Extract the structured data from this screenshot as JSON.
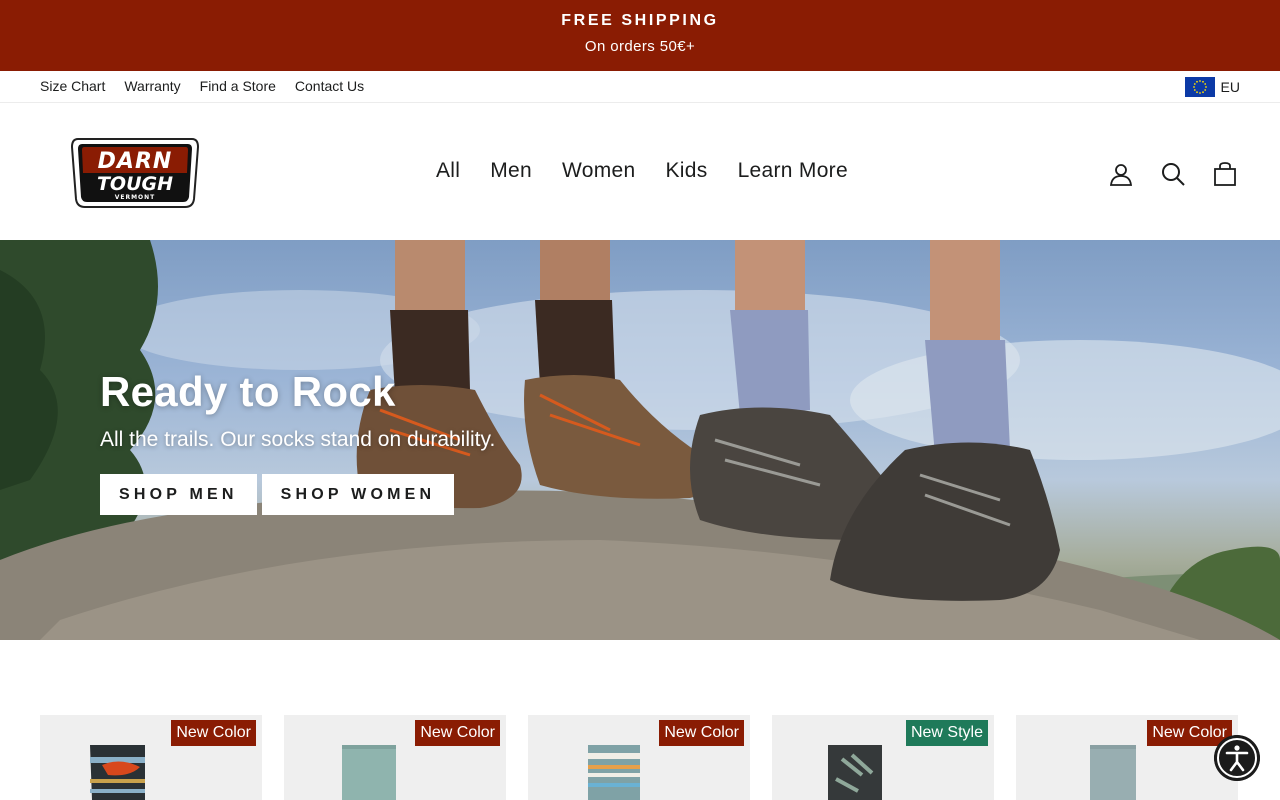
{
  "announcement": {
    "title": "FREE SHIPPING",
    "subtitle": "On orders 50€+"
  },
  "utility": {
    "links": [
      "Size Chart",
      "Warranty",
      "Find a Store",
      "Contact Us"
    ],
    "locale": "EU"
  },
  "logo": {
    "line1": "DARN",
    "line2": "TOUGH",
    "line3": "VERMONT"
  },
  "nav": [
    "All",
    "Men",
    "Women",
    "Kids",
    "Learn More"
  ],
  "header_icons": [
    "account-icon",
    "search-icon",
    "cart-icon"
  ],
  "hero": {
    "title": "Ready to Rock",
    "subtitle": "All the trails. Our socks stand on durability.",
    "buttons": [
      "SHOP MEN",
      "SHOP WOMEN"
    ]
  },
  "products": [
    {
      "badge": "New Color",
      "badge_color": "#8a1c03"
    },
    {
      "badge": "New Color",
      "badge_color": "#8a1c03"
    },
    {
      "badge": "New Color",
      "badge_color": "#8a1c03"
    },
    {
      "badge": "New Style",
      "badge_color": "#1f7a5a"
    },
    {
      "badge": "New Color",
      "badge_color": "#8a1c03"
    }
  ],
  "colors": {
    "brand": "#8a1c03",
    "text": "#1c1d1d"
  }
}
